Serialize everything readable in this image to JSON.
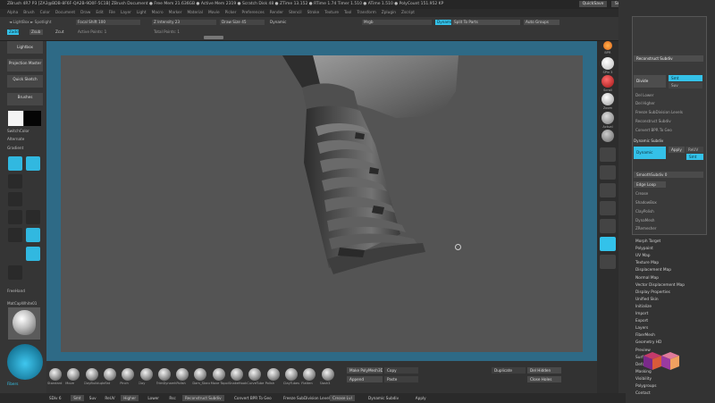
{
  "title_bar": {
    "text": "ZBrush 4R7 P3 [ZA3@BDB-8F6F-QA2B-9D0F-5C1B]   ZBrush Document   ● Free Mem 21.636GB ● Active Mem 2319 ● Scratch Disk 48 ● ZTime 13.152 ● RTime 1.74 Timer 1.510 ● ATime 1.510 ● PolyCount 151.952 KP",
    "quicksave": "QuickSave",
    "see_through": "See-through 0",
    "menus_btn": "Menus",
    "default_script": "DefaultZScript"
  },
  "menu_bar": {
    "items": [
      "Alpha",
      "Brush",
      "Color",
      "Document",
      "Draw",
      "Edit",
      "File",
      "Layer",
      "Light",
      "Macro",
      "Marker",
      "Material",
      "Movie",
      "Picker",
      "Preferences",
      "Render",
      "Stencil",
      "Stroke",
      "Texture",
      "Tool",
      "Transform",
      "Zplugin",
      "Zscript"
    ]
  },
  "top_bar": {
    "lightbox_label": "◄ LightBox ► Spotlight",
    "zadd": "Zadd",
    "zsub": "Zsub",
    "zcut": "Zcut",
    "focal_shift": "Focal Shift 100",
    "z_intensity": "Z Intensity 23",
    "draw_size": "Draw Size 45",
    "dynamic": "Dynamic",
    "active_points": "Active Points: 1",
    "total_points": "Total Points: 1",
    "quick_cut": "Split To Parts",
    "auto_groups": "Auto Groups",
    "tool_slot": "Mrgb"
  },
  "left_panel": {
    "buttons": [
      "Lightbox",
      "Projection Master",
      "Quick Sketch",
      "Brushes"
    ],
    "gradient_label": "SwitchColor",
    "alternate": "Alternate",
    "gradient": "Gradient",
    "brushes_label": "FreeHand",
    "bottom_label": "MatCapWhite01",
    "material": "FlatShaded",
    "brush_name": "Clay",
    "sphere_label": "Fibers"
  },
  "right_rail": {
    "labels": [
      "BPR",
      "SPix 3",
      "Scroll",
      "Zoom",
      "Actual",
      "AAHalf",
      "Persp",
      "Floor",
      "Local",
      "LSym",
      "Frame",
      "Move",
      "Scale",
      "Rotate",
      "PolyF",
      "Transp",
      "Solo",
      "Xpose"
    ]
  },
  "right_panel": {
    "top_button": "Higher Res",
    "sub_button": "Reconstruct Subdiv",
    "group_title": "Subdivide",
    "divide": "Divide",
    "smt": "Smt",
    "suv": "Suv",
    "rsmt": "ReUV",
    "sub_items": [
      "Del Lower",
      "Del Higher",
      "Freeze SubDivision Levels",
      "Reconstruct Subdiv",
      "Convert BPR To Geo"
    ],
    "dynamic_sub": "Dynamic Subdiv",
    "dyn_button": "Dynamic",
    "apply": "Apply",
    "smt2": "SmoothSubdiv 0",
    "geo_items": [
      "Edge Loop",
      "Crease",
      "ShadowBox",
      "ClayPolish",
      "DynaMesh",
      "ZRemesher",
      "Modify Topology",
      "Position",
      "Size",
      "MeshIntegrity"
    ],
    "section_items": [
      "Morph Target",
      "Polypaint",
      "UV Map",
      "Texture Map",
      "Displacement Map",
      "Normal Map",
      "Vector Displacement Map",
      "Display Properties",
      "Unified Skin",
      "Initialize",
      "Import",
      "Export",
      "Layers",
      "FiberMesh",
      "Geometry HD",
      "Preview",
      "Surface",
      "Deformation",
      "Masking",
      "Visibility",
      "Polygroups",
      "Contact"
    ],
    "high_res": "Higher Res",
    "lower": "Lower Res",
    "sdiv": "SDiv 6"
  },
  "bottom_bar": {
    "brushes": [
      "Standard",
      "Move",
      "ClayBuildup",
      "Inflat",
      "Pinch",
      "Clay",
      "TrimDynamic",
      "hPolish",
      "Dam_Standard",
      "Move Topological",
      "SnakeHook",
      "CurveTube",
      "Polish",
      "ClayTubes",
      "Flatten",
      "Slash3"
    ],
    "make_polymesh": "Make PolyMesh3D",
    "copy": "Copy",
    "paste": "Paste",
    "append": "Append",
    "duplicate": "Duplicate",
    "del_hidden": "Del Hidden",
    "close_holes": "Close Holes"
  },
  "status_bar": {
    "items": [
      "SDiv 6",
      "Smt",
      "Suv",
      "ReUV",
      "Higher",
      "Lower",
      "Rsc",
      "Reconstruct Subdiv",
      "Convert BPR To Geo",
      "Freeze SubDivision Levels",
      "Crease Lvl",
      "Dynamic Subdiv",
      "Apply"
    ]
  },
  "colors": {
    "accent": "#34c1e8",
    "frame": "#2e6a86",
    "canvas": "#545454"
  }
}
